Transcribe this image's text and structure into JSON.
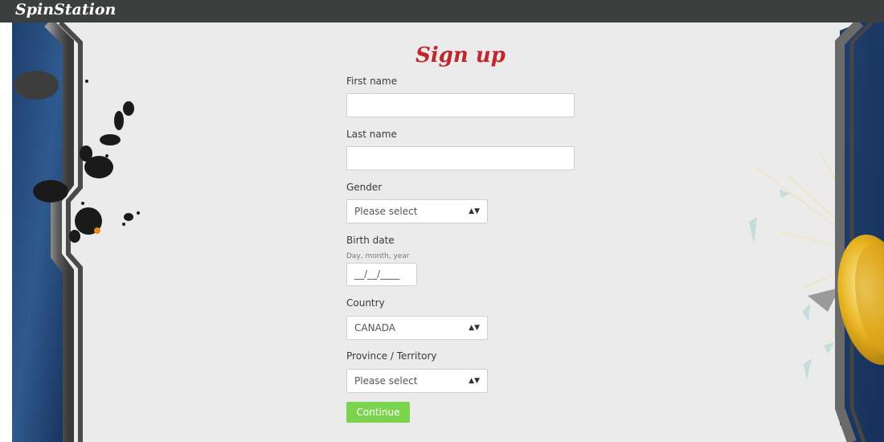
{
  "header": {
    "logo": "SpinStation"
  },
  "form": {
    "title": "Sign up",
    "first_name": {
      "label": "First name",
      "value": ""
    },
    "last_name": {
      "label": "Last name",
      "value": ""
    },
    "gender": {
      "label": "Gender",
      "selected": "Please select"
    },
    "birth_date": {
      "label": "Birth date",
      "hint": "Day, month, year",
      "placeholder": "__/__/____"
    },
    "country": {
      "label": "Country",
      "selected": "CANADA"
    },
    "province": {
      "label": "Province / Territory",
      "selected": "Please select"
    },
    "continue_label": "Continue"
  },
  "colors": {
    "header_bg": "#3b3f3d",
    "page_bg": "#ebebeb",
    "title": "#c0272d",
    "button": "#7cd34e"
  },
  "icons": [
    "select-arrows-icon",
    "asteroid-decoration",
    "gold-coin-decoration",
    "spaceship-frame-decoration"
  ]
}
